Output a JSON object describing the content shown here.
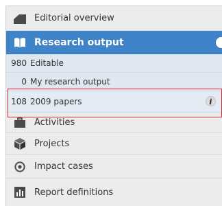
{
  "nav": {
    "editorial": {
      "label": "Editorial overview",
      "icon": "chart-icon"
    },
    "research": {
      "label": "Research output",
      "icon": "book-icon",
      "color": "#3f83c9"
    },
    "sub_items": [
      {
        "count": "980",
        "label": "Editable"
      },
      {
        "count": "0",
        "label": "My research output"
      },
      {
        "count": "108",
        "label": "2009 papers",
        "info": "i"
      }
    ],
    "activities": {
      "label": "Activities",
      "icon": "briefcase-icon"
    },
    "projects": {
      "label": "Projects",
      "icon": "cube-icon"
    },
    "impact": {
      "label": "Impact cases",
      "icon": "target-icon"
    },
    "report": {
      "label": "Report definitions",
      "icon": "bar-chart-icon"
    }
  },
  "highlight_color": "#e0262b"
}
